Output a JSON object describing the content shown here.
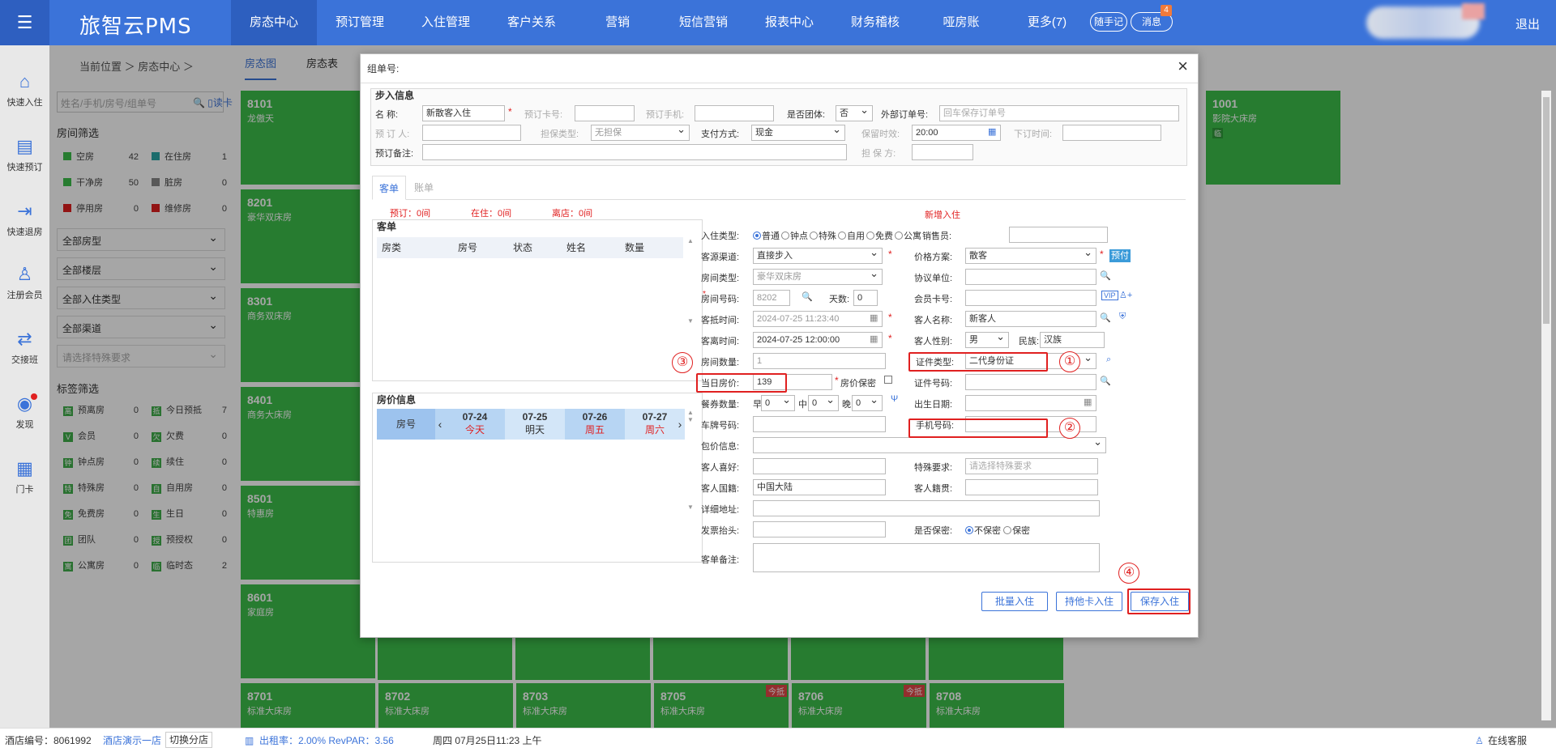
{
  "app": {
    "logo": "旅智云PMS",
    "logout": "退出",
    "quick_note": "随手记",
    "messages": "消息",
    "msg_count": "4"
  },
  "nav": [
    "房态中心",
    "预订管理",
    "入住管理",
    "客户关系",
    "营销",
    "短信营销",
    "报表中心",
    "财务稽核",
    "哑房账",
    "更多(7)"
  ],
  "sidebar": [
    "快速入住",
    "快速预订",
    "快速退房",
    "注册会员",
    "交接班",
    "发现",
    "门卡"
  ],
  "breadcrumb": "当前位置 ＞ 房态中心 ＞",
  "view_tabs": [
    "房态图",
    "房态表"
  ],
  "search": {
    "placeholder": "姓名/手机/房号/组单号",
    "read_card": "读卡"
  },
  "room_filter": {
    "title": "房间筛选",
    "items": [
      {
        "label": "空房",
        "count": "42",
        "color": "#3cbf4a"
      },
      {
        "label": "在住房",
        "count": "1",
        "color": "#2aa6a6"
      },
      {
        "label": "干净房",
        "count": "50",
        "color": "#3cbf4a"
      },
      {
        "label": "脏房",
        "count": "0",
        "color": "#888888"
      },
      {
        "label": "停用房",
        "count": "0",
        "color": "#e02020"
      },
      {
        "label": "维修房",
        "count": "0",
        "color": "#e02020"
      }
    ],
    "selects": [
      "全部房型",
      "全部楼层",
      "全部入住类型",
      "全部渠道"
    ],
    "special_placeholder": "请选择特殊要求"
  },
  "tag_filter": {
    "title": "标签筛选",
    "items": [
      {
        "label": "预离房",
        "count": "0",
        "icon": "离"
      },
      {
        "label": "今日预抵",
        "count": "7",
        "icon": "抵"
      },
      {
        "label": "会员",
        "count": "0",
        "icon": "V"
      },
      {
        "label": "欠费",
        "count": "0",
        "icon": "欠"
      },
      {
        "label": "钟点房",
        "count": "0",
        "icon": "钟"
      },
      {
        "label": "续住",
        "count": "0",
        "icon": "续"
      },
      {
        "label": "特殊房",
        "count": "0",
        "icon": "特"
      },
      {
        "label": "自用房",
        "count": "0",
        "icon": "自"
      },
      {
        "label": "免费房",
        "count": "0",
        "icon": "免"
      },
      {
        "label": "生日",
        "count": "0",
        "icon": "生"
      },
      {
        "label": "团队",
        "count": "0",
        "icon": "团"
      },
      {
        "label": "预授权",
        "count": "0",
        "icon": "授"
      },
      {
        "label": "公寓房",
        "count": "0",
        "icon": "寓"
      },
      {
        "label": "临时态",
        "count": "2",
        "icon": "临"
      }
    ]
  },
  "rooms_left": [
    {
      "num": "8101",
      "type": "龙傲天"
    },
    {
      "num": "8201",
      "type": "豪华双床房"
    },
    {
      "num": "8301",
      "type": "商务双床房"
    },
    {
      "num": "8401",
      "type": "商务大床房"
    },
    {
      "num": "8501",
      "type": "特惠房"
    },
    {
      "num": "8601",
      "type": "家庭房"
    }
  ],
  "room_right": {
    "num": "1001",
    "type": "影院大床房",
    "tag": "临"
  },
  "rooms_bottom": [
    {
      "num": "8701",
      "type": "标准大床房",
      "tag": ""
    },
    {
      "num": "8702",
      "type": "标准大床房",
      "tag": ""
    },
    {
      "num": "8703",
      "type": "标准大床房",
      "tag": ""
    },
    {
      "num": "8705",
      "type": "标准大床房",
      "tag": "今抵"
    },
    {
      "num": "8706",
      "type": "标准大床房",
      "tag": "今抵"
    },
    {
      "num": "8708",
      "type": "标准大床房",
      "tag": ""
    }
  ],
  "status": {
    "hotel_no_label": "酒店编号：8061992",
    "hotel_name": "酒店演示一店",
    "switch": "切换分店",
    "occupancy": "出租率：2.00% RevPAR：3.56",
    "datetime": "周四 07月25日11:23 上午",
    "support": "在线客服"
  },
  "modal": {
    "title": "组单号:",
    "walkin": {
      "title": "步入信息",
      "name_label": "名      称:",
      "name_value": "新散客入住",
      "card_label": "预订卡号:",
      "phone_label": "预订手机:",
      "group_label": "是否团体:",
      "group_value": "否",
      "ext_label": "外部订单号:",
      "ext_placeholder": "回车保存订单号",
      "booker_label": "预 订 人:",
      "guarantee_label": "担保类型:",
      "guarantee_value": "无担保",
      "pay_label": "支付方式:",
      "pay_value": "现金",
      "keep_label": "保留时效:",
      "keep_value": "20:00",
      "order_time_label": "下订时间:",
      "remark_label": "预订备注:",
      "guarantor_label": "担 保 方:"
    },
    "tabs": [
      "客单",
      "账单"
    ],
    "counts": {
      "reserved": "预订：0间",
      "in": "在住：0间",
      "left": "离店：0间"
    },
    "new_checkin": "新增入住",
    "guest_list": {
      "title": "客单",
      "cols": [
        "房类",
        "房号",
        "状态",
        "姓名",
        "数量"
      ]
    },
    "price_info": {
      "title": "房价信息",
      "room_col": "房号",
      "days": [
        {
          "date": "07-24",
          "label": "今天"
        },
        {
          "date": "07-25",
          "label": "明天"
        },
        {
          "date": "07-26",
          "label": "周五"
        },
        {
          "date": "07-27",
          "label": "周六"
        }
      ]
    },
    "form": {
      "checkin_type_label": "入住类型:",
      "checkin_types": [
        "普通",
        "钟点",
        "特殊",
        "自用",
        "免费",
        "公寓"
      ],
      "sales_label": "销售员:",
      "source_label": "客源渠道:",
      "source_value": "直接步入",
      "price_plan_label": "价格方案:",
      "price_plan_value": "散客",
      "prepay": "预付",
      "room_type_label": "房间类型:",
      "room_type_value": "豪华双床房",
      "agreement_label": "协议单位:",
      "room_no_label": "房间号码:",
      "room_no_value": "8202",
      "days_label": "天数:",
      "days_value": "0",
      "member_label": "会员卡号:",
      "vip": "VIP",
      "arrive_label": "客抵时间:",
      "arrive_value": "2024-07-25 11:23:40",
      "guest_name_label": "客人名称:",
      "guest_name_value": "新客人",
      "leave_label": "客离时间:",
      "leave_value": "2024-07-25 12:00:00",
      "gender_label": "客人性别:",
      "gender_value": "男",
      "ethnic_label": "民族:",
      "ethnic_value": "汉族",
      "room_count_label": "房间数量:",
      "room_count_value": "1",
      "id_type_label": "证件类型:",
      "id_type_value": "二代身份证",
      "price_label": "当日房价:",
      "price_value": "139",
      "price_secret_label": "房价保密",
      "id_no_label": "证件号码:",
      "meal_label": "餐券数量:",
      "meal_b": "早",
      "meal_l": "中",
      "meal_d": "晚",
      "meal_value": "0",
      "birth_label": "出生日期:",
      "plate_label": "车牌号码:",
      "mobile_label": "手机号码:",
      "package_label": "包价信息:",
      "hobby_label": "客人喜好:",
      "special_label": "特殊要求:",
      "special_placeholder": "请选择特殊要求",
      "nation_label": "客人国籍:",
      "nation_value": "中国大陆",
      "native_label": "客人籍贯:",
      "address_label": "详细地址:",
      "invoice_label": "发票抬头:",
      "secret_label": "是否保密:",
      "secret_no": "不保密",
      "secret_yes": "保密",
      "remark_label": "客单备注:"
    },
    "buttons": {
      "batch": "批量入住",
      "other_card": "持他卡入住",
      "save": "保存入住"
    },
    "markers": [
      "①",
      "②",
      "③",
      "④"
    ]
  }
}
